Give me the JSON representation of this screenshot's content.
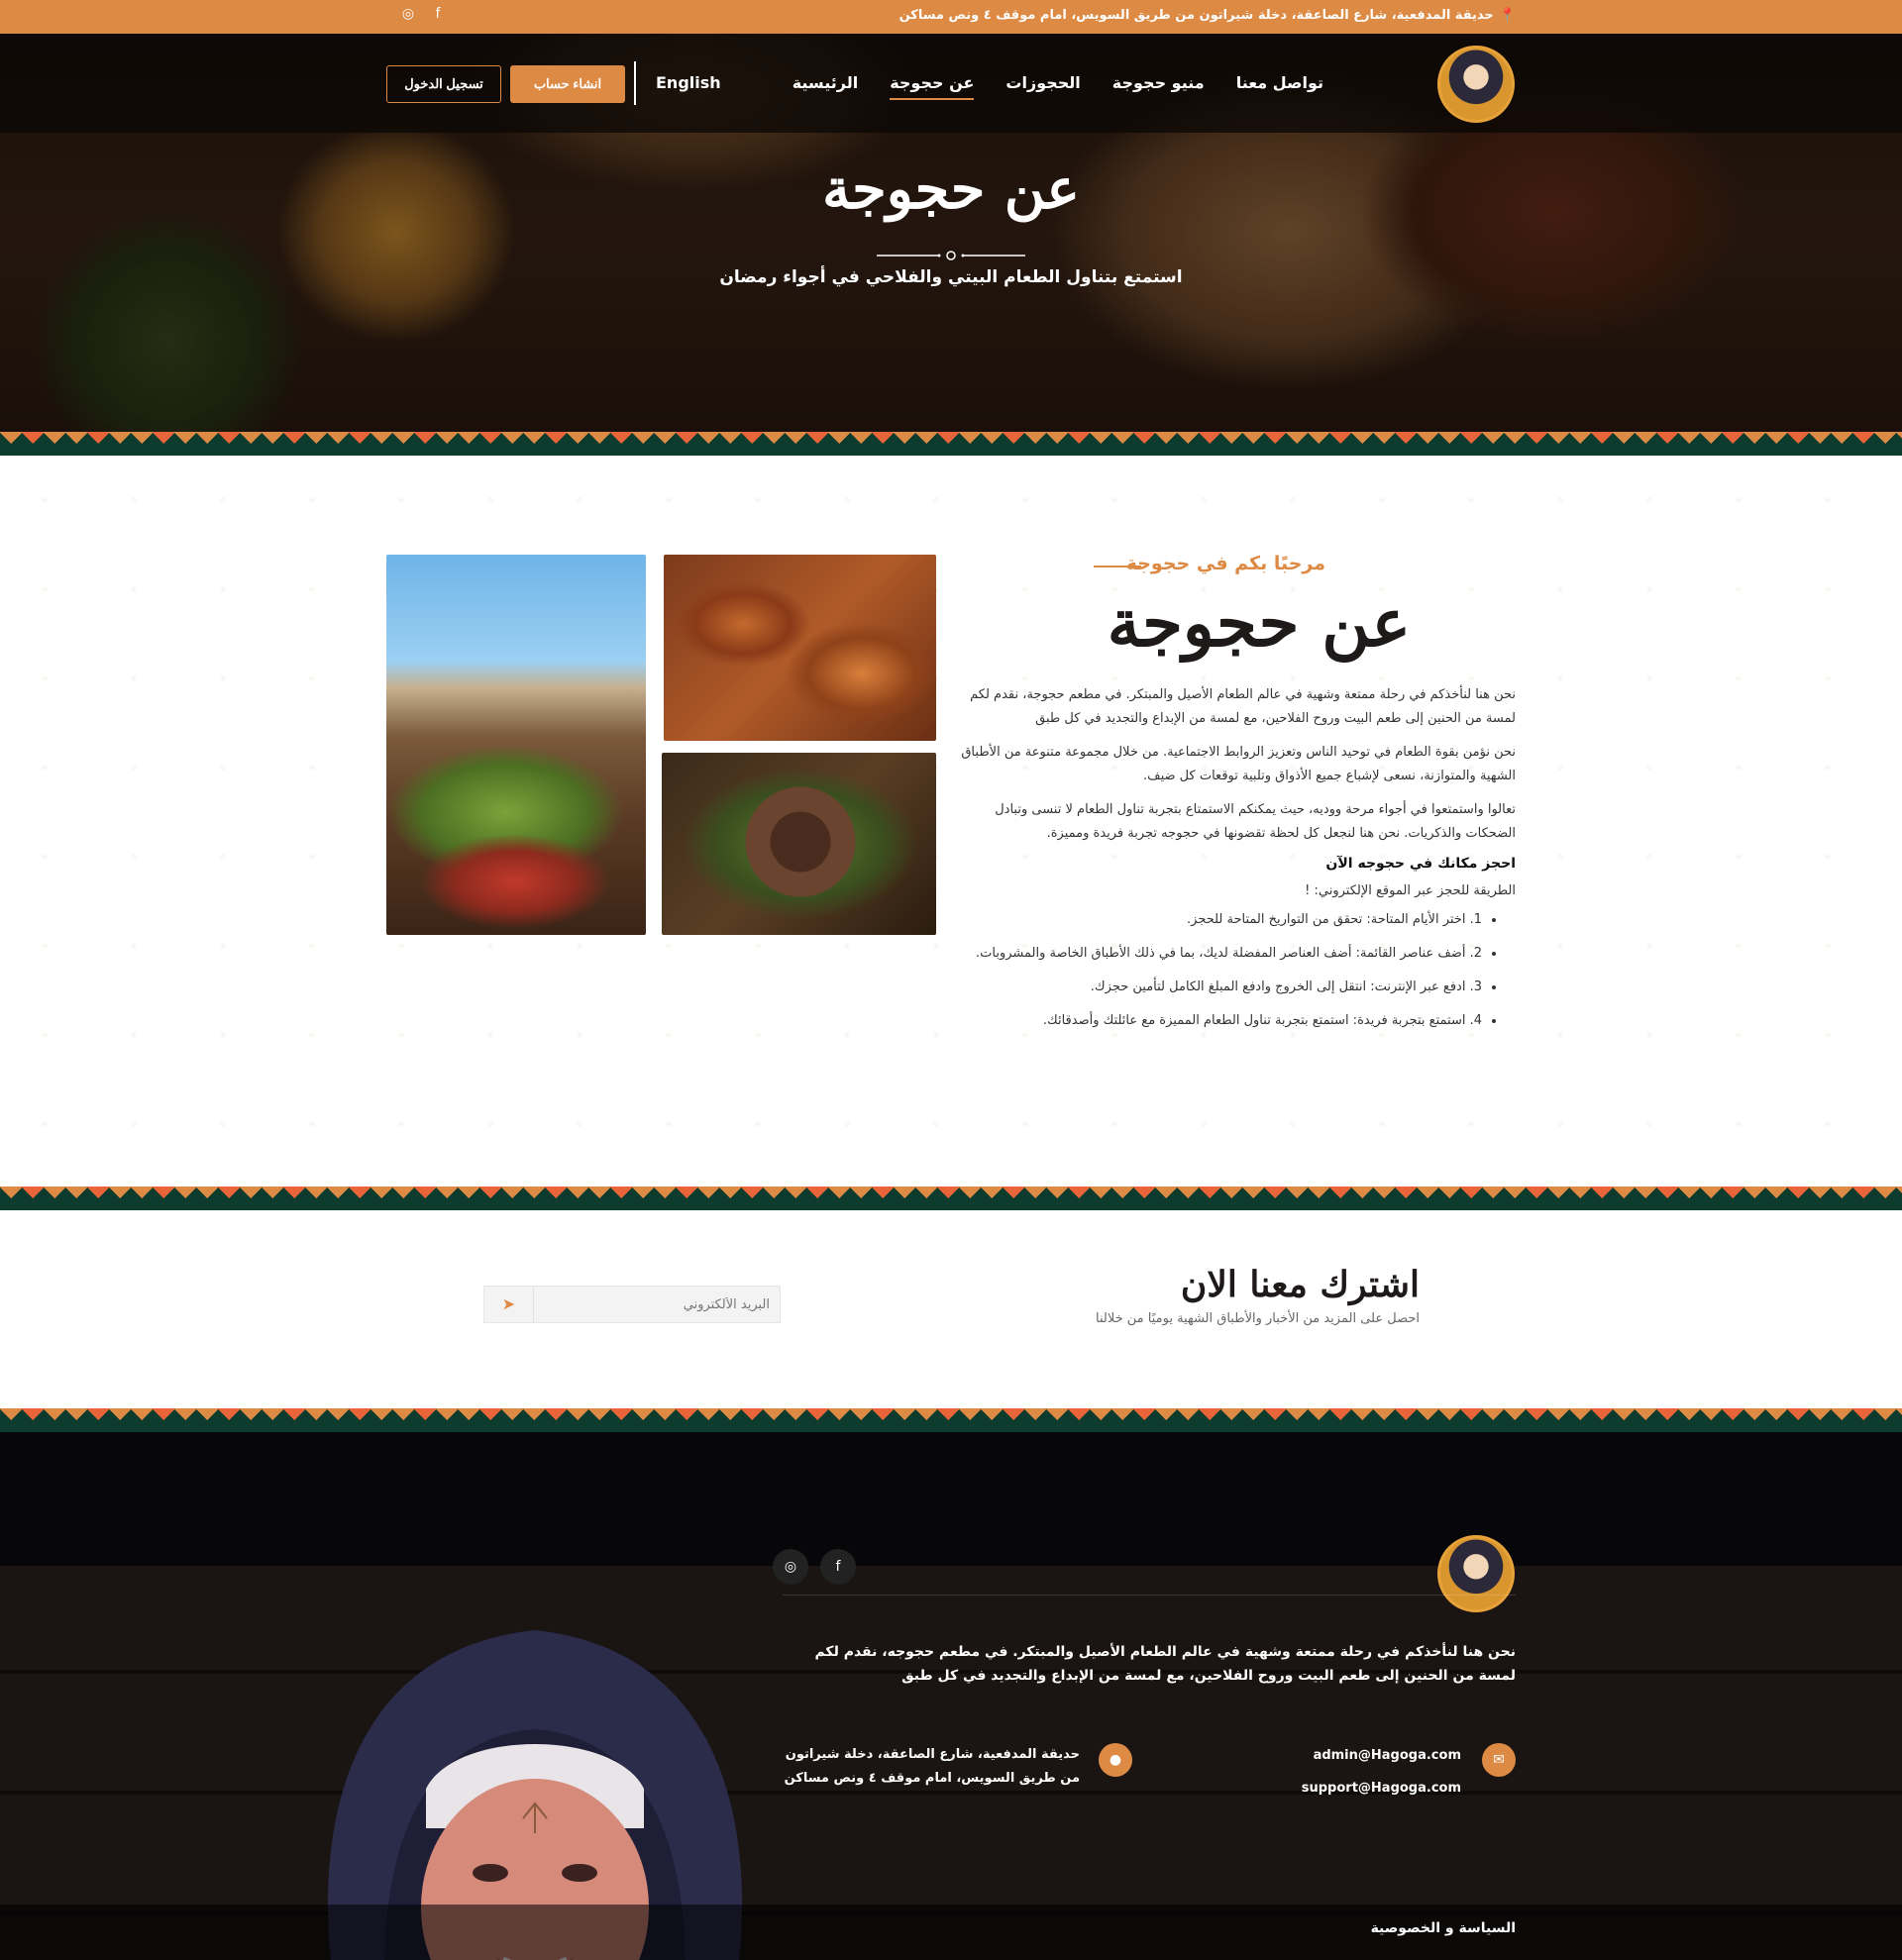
{
  "topbar": {
    "address": "حديقة المدفعية، شارع الصاعقة، دخلة شيراتون من طريق السويس، امام موقف ٤ ونص مساكن",
    "social": [
      "instagram-icon",
      "facebook-icon"
    ],
    "instagram_glyph": "◎",
    "facebook_glyph": "f",
    "pin_glyph": "⬤"
  },
  "nav": {
    "items": [
      {
        "label": "الرئيسية"
      },
      {
        "label": "عن حجوجة"
      },
      {
        "label": "الحجوزات"
      },
      {
        "label": "منيو حجوجة"
      },
      {
        "label": "تواصل معنا"
      }
    ],
    "active_item": "عن حجوجة",
    "language": "English",
    "signup_label": "انشاء حساب",
    "login_label": "تسجيل الدخول"
  },
  "hero": {
    "title": "عن حجوجة",
    "subtitle": "استمتع بتناول الطعام البيتي والفلاحي في أجواء رمضان"
  },
  "about": {
    "kicker": "مرحبًا بكم في حجوجة",
    "title": "عن حجوجة",
    "paragraphs": [
      "نحن هنا لنأخذكم في رحلة ممتعة وشهية في عالم الطعام الأصيل والمبتكر. في مطعم حجوجة، نقدم لكم لمسة من الحنين إلى طعم البيت وروح الفلاحين، مع لمسة من الإبداع والتجديد في كل طبق",
      "نحن نؤمن بقوة الطعام في توحيد الناس وتعزيز الروابط الاجتماعية. من خلال مجموعة متنوعة من الأطباق الشهية والمتوازنة، نسعى لإشباع جميع الأذواق وتلبية توقعات كل ضيف.",
      "تعالوا واستمتعوا في أجواء مرحة ووديه، حيث يمكنكم الاستمتاع بتجربة تناول الطعام لا تنسى وتبادل الضحكات والذكريات. نحن هنا لنجعل كل لحظة تقضونها في حجوجه تجربة فريدة ومميزة."
    ],
    "booking_heading": "احجز مكانك في حجوجه الآن",
    "booking_intro": "الطريقة للحجز عبر الموقع الإلكتروني: !",
    "steps": [
      "1. اختر الأيام المتاحة: تحقق من التواريخ المتاحة للحجز.",
      "2. أضف عناصر القائمة: أضف العناصر المفضلة لديك، بما في ذلك الأطباق الخاصة والمشروبات.",
      "3. ادفع عبر الإنترنت: انتقل إلى الخروج وادفع المبلغ الكامل لتأمين حجزك.",
      "4. استمتع بتجربة فريدة: استمتع بتجربة تناول الطعام المميزة مع عائلتك وأصدقائك."
    ]
  },
  "newsletter": {
    "title": "اشترك معنا الان",
    "subtitle": "احصل على المزيد من الأخبار والأطباق الشهية يوميًا من خلالنا",
    "email_placeholder": "البريد الألكتروني",
    "send_icon": "➤"
  },
  "footer": {
    "about_text": "نحن هنا لنأخذكم في رحلة ممتعة وشهية في عالم الطعام الأصيل والمبتكر. في مطعم حجوجه، نقدم لكم لمسة من الحنين إلى طعم البيت وروح الفلاحين، مع لمسة من الإبداع والتجديد في كل طبق",
    "emails": [
      "admin@Hagoga.com",
      "support@Hagoga.com"
    ],
    "address": "حديقة المدفعية، شارع الصاعقة، دخلة شيراتون من طريق السويس، امام موقف ٤ ونص مساكن",
    "mail_glyph": "✉",
    "pin_glyph": "●",
    "instagram_glyph": "◎",
    "facebook_glyph": "f",
    "policy_label": "السياسة و الخصوصية"
  },
  "colors": {
    "accent": "#dc8a44",
    "dark_green": "#0d3b2e",
    "footer_bg": "#1a1412"
  }
}
